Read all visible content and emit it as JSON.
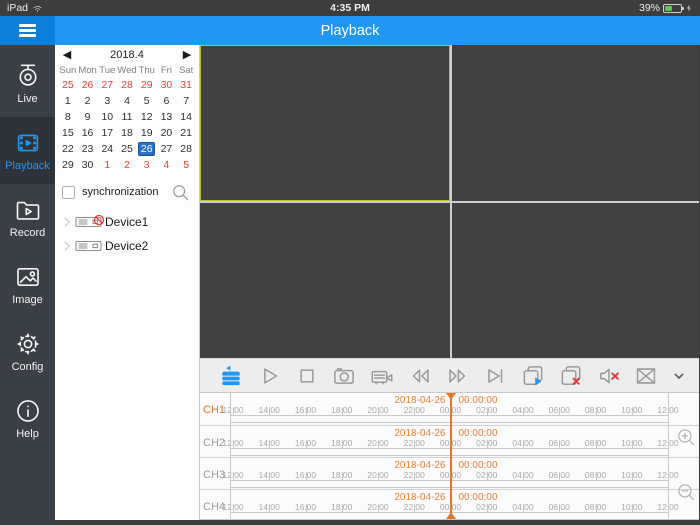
{
  "colors": {
    "accent": "#2196f3",
    "timeline_orange": "#e0772f",
    "calendar_red": "#e8413c",
    "battery_green": "#58c95a"
  },
  "status_bar": {
    "device_label": "iPad",
    "wifi_icon": "wifi-icon",
    "time": "4:35 PM",
    "battery_percent": "39%",
    "charging_icon": "lightning-bolt-icon"
  },
  "title_bar": {
    "title": "Playback",
    "menu_icon": "hamburger-menu-icon"
  },
  "sidebar": {
    "items": [
      {
        "id": "live",
        "label": "Live",
        "icon": "live-camera-icon",
        "active": false
      },
      {
        "id": "playback",
        "label": "Playback",
        "icon": "playback-film-icon",
        "active": true
      },
      {
        "id": "record",
        "label": "Record",
        "icon": "record-folder-icon",
        "active": false
      },
      {
        "id": "image",
        "label": "Image",
        "icon": "image-photo-icon",
        "active": false
      },
      {
        "id": "config",
        "label": "Config",
        "icon": "config-gear-icon",
        "active": false
      },
      {
        "id": "help",
        "label": "Help",
        "icon": "help-circle-icon",
        "active": false
      }
    ]
  },
  "calendar": {
    "title": "2018.4",
    "prev_icon": "◀",
    "next_icon": "▶",
    "weekdays": [
      "Sun",
      "Mon",
      "Tue",
      "Wed",
      "Thu",
      "Fri",
      "Sat"
    ],
    "weeks": [
      [
        {
          "d": "25",
          "out": true
        },
        {
          "d": "26",
          "out": true
        },
        {
          "d": "27",
          "out": true
        },
        {
          "d": "28",
          "out": true
        },
        {
          "d": "29",
          "out": true
        },
        {
          "d": "30",
          "out": true
        },
        {
          "d": "31",
          "out": true
        }
      ],
      [
        {
          "d": "1"
        },
        {
          "d": "2"
        },
        {
          "d": "3"
        },
        {
          "d": "4"
        },
        {
          "d": "5"
        },
        {
          "d": "6"
        },
        {
          "d": "7"
        }
      ],
      [
        {
          "d": "8"
        },
        {
          "d": "9"
        },
        {
          "d": "10"
        },
        {
          "d": "11"
        },
        {
          "d": "12"
        },
        {
          "d": "13"
        },
        {
          "d": "14"
        }
      ],
      [
        {
          "d": "15"
        },
        {
          "d": "16"
        },
        {
          "d": "17"
        },
        {
          "d": "18"
        },
        {
          "d": "19"
        },
        {
          "d": "20"
        },
        {
          "d": "21"
        }
      ],
      [
        {
          "d": "22"
        },
        {
          "d": "23"
        },
        {
          "d": "24"
        },
        {
          "d": "25"
        },
        {
          "d": "26",
          "sel": true
        },
        {
          "d": "27"
        },
        {
          "d": "28"
        }
      ],
      [
        {
          "d": "29"
        },
        {
          "d": "30"
        },
        {
          "d": "1",
          "out": true
        },
        {
          "d": "2",
          "out": true
        },
        {
          "d": "3",
          "out": true
        },
        {
          "d": "4",
          "out": true
        },
        {
          "d": "5",
          "out": true
        }
      ]
    ]
  },
  "device_panel": {
    "sync_label": "synchronization",
    "sync_checked": false,
    "search_icon": "search-icon",
    "devices": [
      {
        "name": "Device1",
        "offline": true
      },
      {
        "name": "Device2",
        "offline": false
      }
    ]
  },
  "video_grid": {
    "pane_count": 4,
    "selected_pane": 0
  },
  "toolbar": {
    "buttons": [
      {
        "name": "device-list-button",
        "icon": "device-stack-icon",
        "active": true
      },
      {
        "name": "play-button",
        "icon": "play-icon",
        "active": false
      },
      {
        "name": "stop-button",
        "icon": "stop-icon",
        "active": false
      },
      {
        "name": "snapshot-button",
        "icon": "camera-icon",
        "active": false
      },
      {
        "name": "record-button",
        "icon": "camcorder-icon",
        "active": false
      },
      {
        "name": "rewind-button",
        "icon": "rewind-icon",
        "active": false
      },
      {
        "name": "fast-forward-button",
        "icon": "fast-forward-icon",
        "active": false
      },
      {
        "name": "frame-step-button",
        "icon": "step-forward-icon",
        "active": false
      },
      {
        "name": "play-all-button",
        "icon": "windows-play-icon",
        "active": false
      },
      {
        "name": "close-all-button",
        "icon": "windows-close-icon",
        "active": false
      },
      {
        "name": "mute-button",
        "icon": "speaker-mute-icon",
        "active": false
      },
      {
        "name": "close-channel-button",
        "icon": "x-box-icon",
        "active": false
      }
    ],
    "collapse_button": {
      "name": "collapse-toolbar-button",
      "icon": "chevron-down-icon"
    }
  },
  "timeline": {
    "date": "2018-04-26",
    "time": "00:00:00",
    "ticks": [
      "12:00",
      "14:00",
      "16:00",
      "18:00",
      "20:00",
      "22:00",
      "00:00",
      "02:00",
      "04:00",
      "06:00",
      "08:00",
      "10:00",
      "12:00"
    ],
    "playhead_index": 6,
    "channels": [
      {
        "label": "CH1",
        "selected": true
      },
      {
        "label": "CH2",
        "selected": false
      },
      {
        "label": "CH3",
        "selected": false
      },
      {
        "label": "CH4",
        "selected": false
      }
    ],
    "zoom_in_icon": "zoom-in-icon",
    "zoom_out_icon": "zoom-out-icon"
  }
}
